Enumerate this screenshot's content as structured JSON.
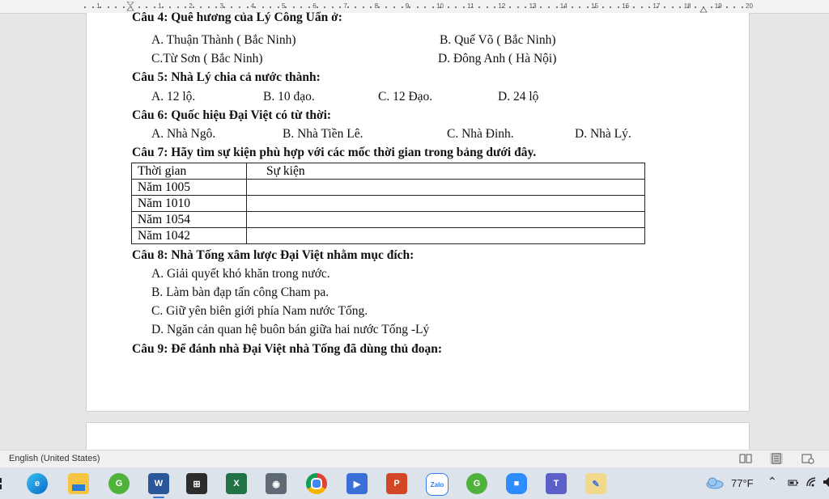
{
  "ruler": {
    "numbers": [
      "1",
      "1",
      "2",
      "3",
      "4",
      "5",
      "6",
      "7",
      "8",
      "9",
      "10",
      "11",
      "12",
      "13",
      "14",
      "15",
      "16",
      "17",
      "18",
      "19",
      "20"
    ]
  },
  "document": {
    "q4": {
      "title": "Câu 4: Quê hương của Lý Công Uẩn ở:",
      "a": "A.  Thuận Thành ( Bắc Ninh)",
      "b": "B. Quế Võ ( Bắc Ninh)",
      "c": "C.Từ Sơn ( Bắc Ninh)",
      "d": "D. Đông Anh ( Hà Nội)"
    },
    "q5": {
      "title": "Câu 5: Nhà Lý chia cả nước thành:",
      "a": "A.  12 lộ.",
      "b": "B. 10 đạo.",
      "c": "C. 12 Đạo.",
      "d": "D. 24 lộ"
    },
    "q6": {
      "title": "Câu 6: Quốc hiệu Đại Việt có từ thời:",
      "a": "A.  Nhà Ngô.",
      "b": "B. Nhà Tiền Lê.",
      "c": "C. Nhà Đinh.",
      "d": "D. Nhà Lý."
    },
    "q7": {
      "title": "Câu 7: Hãy tìm sự kiện  phù hợp với các mốc thời gian trong bảng dưới đây.",
      "table": {
        "headers": [
          "Thời gian",
          "Sự kiện"
        ],
        "rows": [
          [
            "Năm 1005",
            ""
          ],
          [
            "Năm 1010",
            ""
          ],
          [
            "Năm 1054",
            ""
          ],
          [
            "Năm 1042",
            ""
          ]
        ]
      }
    },
    "q8": {
      "title": "Câu 8: Nhà Tống xâm lược Đại Việt nhằm mục đích:",
      "a": "A.  Giải quyết khó khăn trong nước.",
      "b": "B.  Làm bàn đạp tấn công Cham pa.",
      "c": "C.  Giữ yên biên giới phía Nam nước Tống.",
      "d": "D.  Ngăn cản quan hệ buôn bán giữa hai nước Tống -Lý"
    },
    "q9": {
      "title": "Câu 9: Để đánh nhà Đại Việt nhà Tống đã dùng thủ đoạn:"
    }
  },
  "status_bar": {
    "language": "English (United States)"
  },
  "taskbar": {
    "icons": [
      "windows-icon",
      "edge-icon",
      "file-explorer-icon",
      "coccoc-icon",
      "word-icon",
      "store-icon",
      "excel-icon",
      "camera-icon",
      "chrome-icon",
      "video-icon",
      "powerpoint-icon",
      "zalo-icon",
      "coccoc-icon",
      "zoom-icon",
      "teams-icon",
      "paint-icon"
    ],
    "zalo_label": "Zalo",
    "temperature": "77°F"
  },
  "colors": {
    "word": "#2b579a",
    "excel": "#217346",
    "powerpoint": "#d24726",
    "accent": "#3b7bd4"
  }
}
